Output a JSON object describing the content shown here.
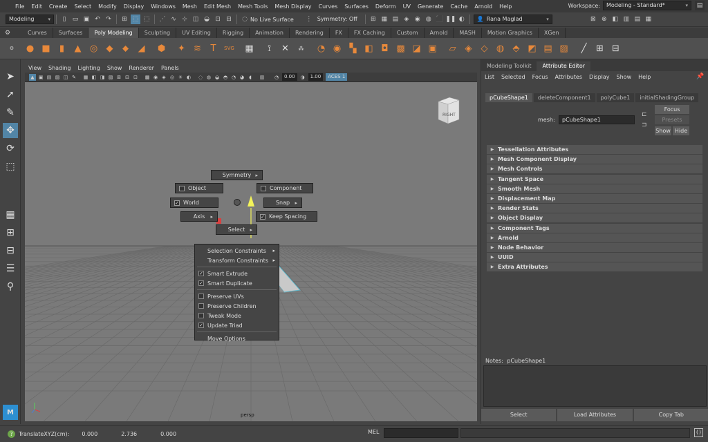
{
  "menubar": {
    "items": [
      "File",
      "Edit",
      "Create",
      "Select",
      "Modify",
      "Display",
      "Windows",
      "Mesh",
      "Edit Mesh",
      "Mesh Tools",
      "Mesh Display",
      "Curves",
      "Surfaces",
      "Deform",
      "UV",
      "Generate",
      "Cache",
      "Arnold",
      "Help"
    ],
    "workspace_label": "Workspace:",
    "workspace_value": "Modeling - Standard*"
  },
  "statusline": {
    "menuset": "Modeling",
    "live_surface": "No Live Surface",
    "symmetry": "Symmetry: Off",
    "user": "Rana Maglad"
  },
  "shelf": {
    "tabs": [
      "Curves",
      "Surfaces",
      "Poly Modeling",
      "Sculpting",
      "UV Editing",
      "Rigging",
      "Animation",
      "Rendering",
      "FX",
      "FX Caching",
      "Custom",
      "Arnold",
      "MASH",
      "Motion Graphics",
      "XGen"
    ],
    "active_tab": "Poly Modeling"
  },
  "viewport": {
    "menu": [
      "View",
      "Shading",
      "Lighting",
      "Show",
      "Renderer",
      "Panels"
    ],
    "exposure": "0.00",
    "gamma": "1.00",
    "colorspace": "ACES 1",
    "camera_label": "persp",
    "viewcube_label": "RIGHT"
  },
  "marking_menu": {
    "north": "Symmetry",
    "west_top": "Object",
    "east_top": "Component",
    "west": "World",
    "east": "Snap",
    "southwest": "Axis",
    "southeast": "Keep Spacing",
    "south": "Select"
  },
  "context_menu": {
    "items": [
      {
        "label": "Selection Constraints",
        "kind": "sub"
      },
      {
        "label": "Transform Constraints",
        "kind": "sub"
      },
      {
        "label": "Smart Extrude",
        "kind": "checked"
      },
      {
        "label": "Smart Duplicate",
        "kind": "checked"
      },
      {
        "label": "Preserve UVs",
        "kind": "unchecked"
      },
      {
        "label": "Preserve Children",
        "kind": "unchecked"
      },
      {
        "label": "Tweak Mode",
        "kind": "unchecked"
      },
      {
        "label": "Update Triad",
        "kind": "checked"
      },
      {
        "label": "Move Options",
        "kind": "plain"
      }
    ]
  },
  "right_panel": {
    "tabs": [
      "Modeling Toolkit",
      "Attribute Editor"
    ],
    "active_tab": "Attribute Editor",
    "menu": [
      "List",
      "Selected",
      "Focus",
      "Attributes",
      "Display",
      "Show",
      "Help"
    ],
    "node_tabs": [
      "pCubeShape1",
      "deleteComponent1",
      "polyCube1",
      "initialShadingGroup"
    ],
    "active_node_tab": "pCubeShape1",
    "mesh_label": "mesh:",
    "mesh_value": "pCubeShape1",
    "focus_button": "Focus",
    "presets_button": "Presets",
    "show_button": "Show",
    "hide_button": "Hide",
    "sections": [
      "Tessellation Attributes",
      "Mesh Component Display",
      "Mesh Controls",
      "Tangent Space",
      "Smooth Mesh",
      "Displacement Map",
      "Render Stats",
      "Object Display",
      "Component Tags",
      "Arnold",
      "Node Behavior",
      "UUID",
      "Extra Attributes"
    ],
    "notes_label": "Notes:",
    "notes_node": "pCubeShape1",
    "bottom_buttons": [
      "Select",
      "Load Attributes",
      "Copy Tab"
    ]
  },
  "helpline": {
    "label": "TranslateXYZ(cm):",
    "x": "0.000",
    "y": "2.736",
    "z": "0.000",
    "mel": "MEL"
  },
  "colors": {
    "shelf_icon": "#e8893b",
    "selected_tool": "#5285a6",
    "viewport_bg": "#7a7a7a"
  }
}
